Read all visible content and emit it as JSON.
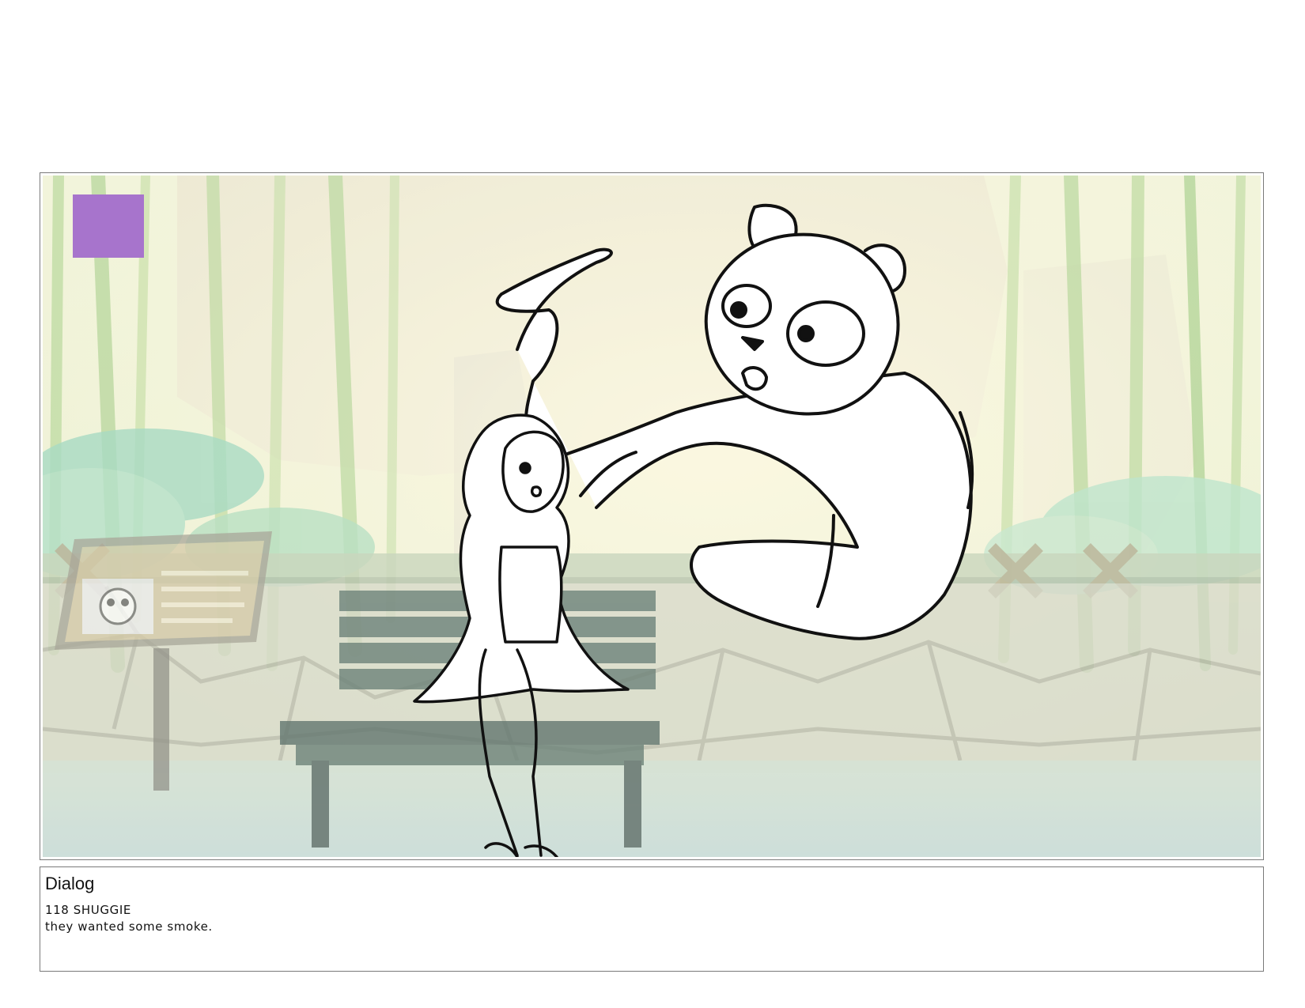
{
  "panel": {
    "marker_color": "#a774cc",
    "sketch_stroke": "#111111"
  },
  "dialog": {
    "heading": "Dialog",
    "lines": [
      "118 SHUGGIE",
      "they wanted some smoke."
    ]
  }
}
